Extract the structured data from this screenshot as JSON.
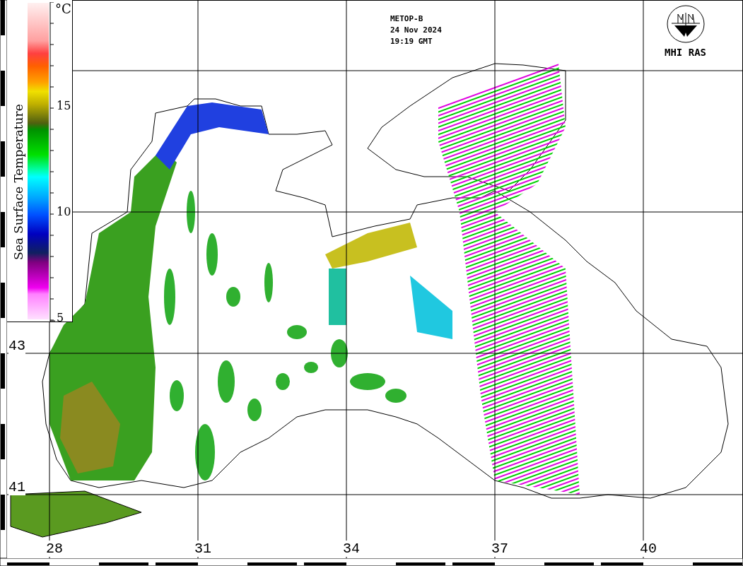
{
  "header": {
    "satellite": "METOP-B",
    "date": "24 Nov 2024",
    "time": "19:19 GMT"
  },
  "logo": {
    "text": "MHI RAS"
  },
  "colorbar": {
    "title": "Sea Surface Temperature",
    "unit": "°C",
    "ticks": [
      "15",
      "10",
      "5"
    ]
  },
  "lon_labels": [
    "28",
    "31",
    "34",
    "37",
    "40"
  ],
  "lat_labels": [
    "43",
    "41"
  ]
}
